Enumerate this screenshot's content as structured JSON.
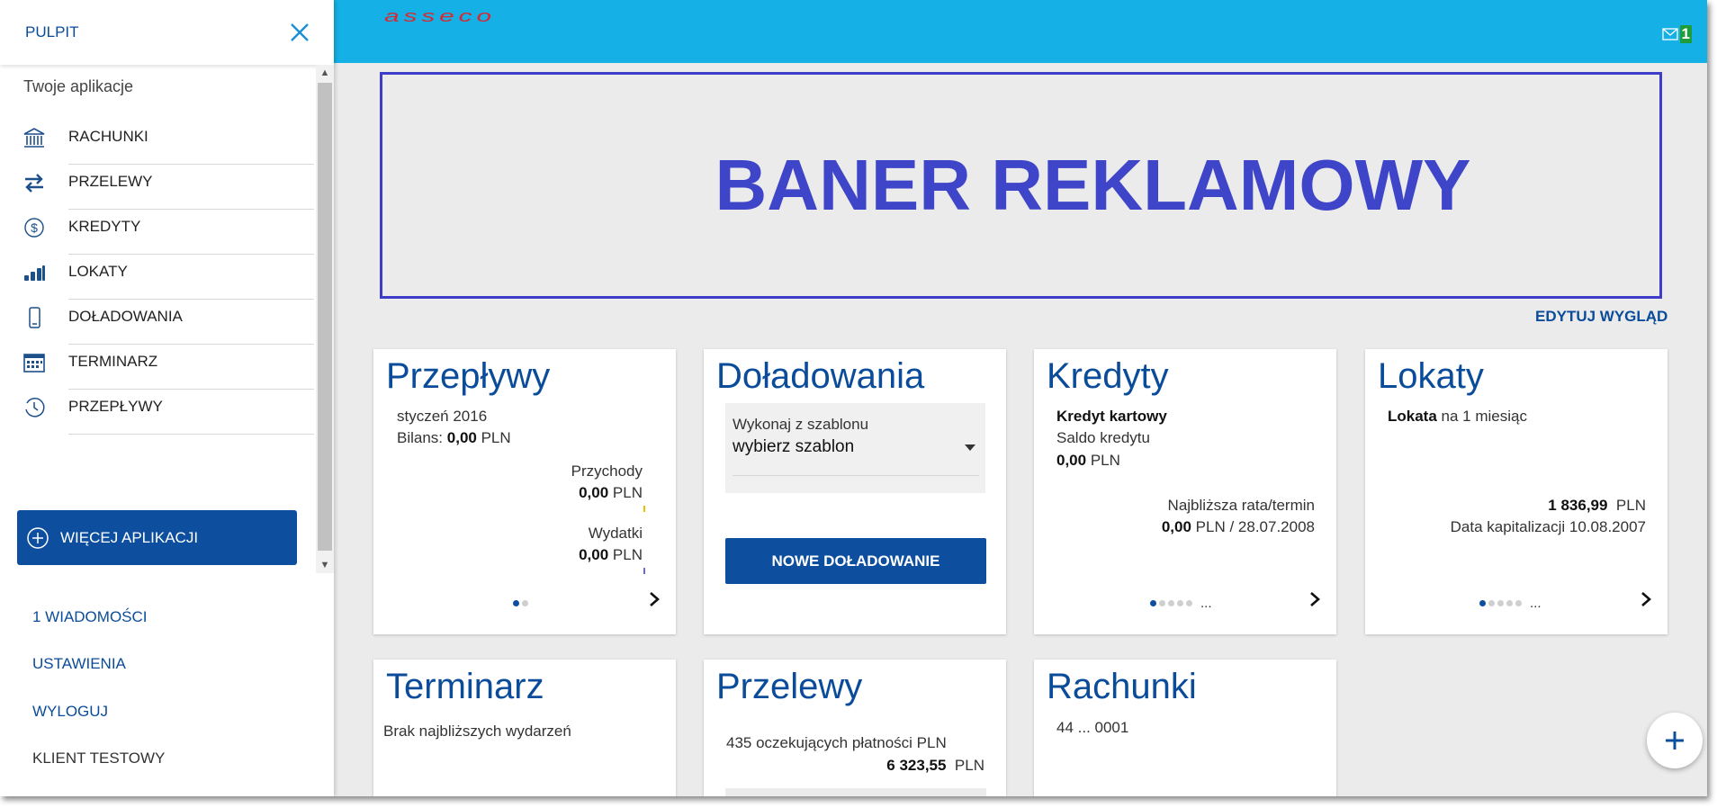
{
  "sidebar": {
    "title": "PULPIT",
    "apps_label": "Twoje aplikacje",
    "items": [
      {
        "label": "RACHUNKI",
        "icon": "bank-icon"
      },
      {
        "label": "PRZELEWY",
        "icon": "transfer-arrows-icon"
      },
      {
        "label": "KREDYTY",
        "icon": "dollar-circle-icon"
      },
      {
        "label": "LOKATY",
        "icon": "coins-stack-icon"
      },
      {
        "label": "DOŁADOWANIA",
        "icon": "mobile-phone-icon"
      },
      {
        "label": "TERMINARZ",
        "icon": "calendar-icon"
      },
      {
        "label": "PRZEPŁYWY",
        "icon": "clock-flow-icon"
      }
    ],
    "more_apps": "WIĘCEJ APLIKACJI",
    "links": {
      "messages": "1 WIADOMOŚCI",
      "settings": "USTAWIENIA",
      "logout": "WYLOGUJ",
      "client": "KLIENT TESTOWY"
    }
  },
  "topbar": {
    "logo": "asseco",
    "mail_count": "1"
  },
  "banner": {
    "text": "BANER REKLAMOWY"
  },
  "edit_look": "EDYTUJ WYGLĄD",
  "cards": {
    "przeplywy": {
      "title": "Przepływy",
      "month": "styczeń 2016",
      "balance_label": "Bilans:",
      "balance_value": "0,00",
      "currency": "PLN",
      "income_label": "Przychody",
      "income_value": "0,00",
      "expense_label": "Wydatki",
      "expense_value": "0,00"
    },
    "doladowania": {
      "title": "Doładowania",
      "template_label": "Wykonaj z szablonu",
      "template_value": "wybierz szablon",
      "button": "NOWE DOŁADOWANIE"
    },
    "kredyty": {
      "title": "Kredyty",
      "name": "Kredyt kartowy",
      "saldo_label": "Saldo kredytu",
      "saldo_value": "0,00",
      "currency": "PLN",
      "next_label": "Najbliższa rata/termin",
      "next_value": "0,00",
      "next_rest": "PLN / 28.07.2008",
      "more": "..."
    },
    "lokaty": {
      "title": "Lokaty",
      "name_bold": "Lokata",
      "name_rest": "na 1 miesiąc",
      "amount": "1 836,99",
      "currency": "PLN",
      "cap_date": "Data kapitalizacji 10.08.2007",
      "more": "..."
    },
    "terminarz": {
      "title": "Terminarz",
      "empty": "Brak najbliższych wydarzeń"
    },
    "przelewy": {
      "title": "Przelewy",
      "pending": "435 oczekujących płatności PLN",
      "amount": "6 323,55",
      "currency": "PLN"
    },
    "rachunki": {
      "title": "Rachunki",
      "account": "44 ... 0001"
    }
  },
  "colors": {
    "topbar": "#14b0e6",
    "brand_blue": "#0d4f9e",
    "banner_blue": "#3f45c8",
    "logo_red": "#d9282f",
    "mail_badge": "#1f9d3a"
  }
}
